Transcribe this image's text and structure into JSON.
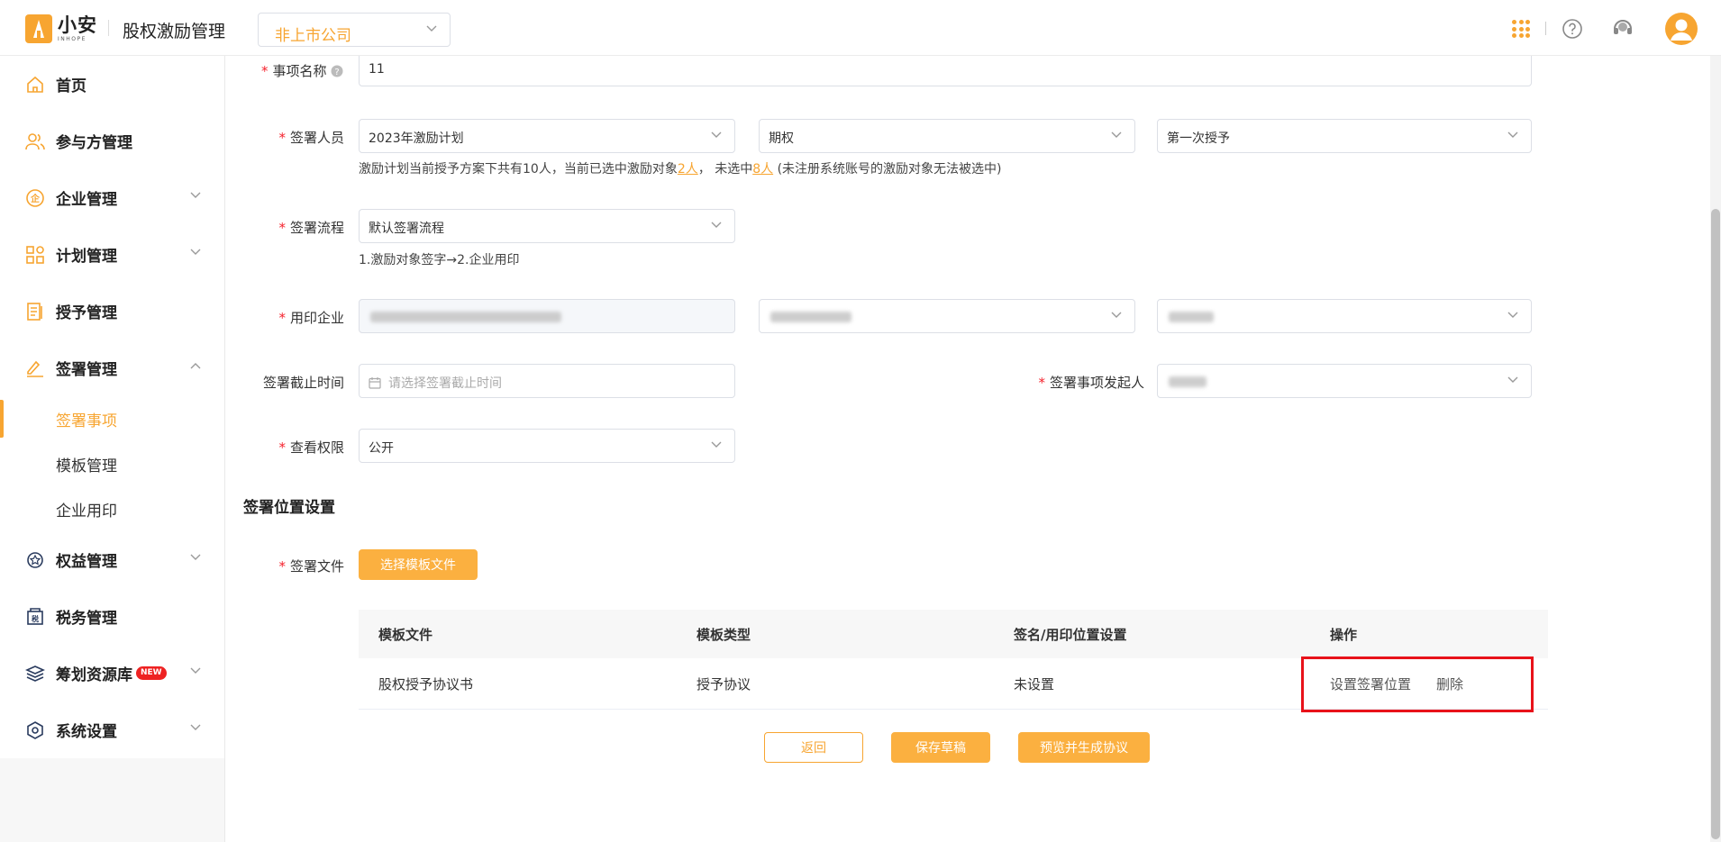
{
  "header": {
    "logo_cn": "小安",
    "logo_en": "INHOPE",
    "app_title": "股权激励管理",
    "company_select": "非上市公司"
  },
  "sidebar": {
    "items": [
      {
        "label": "首页",
        "icon": "home-icon"
      },
      {
        "label": "参与方管理",
        "icon": "users-icon"
      },
      {
        "label": "企业管理",
        "icon": "enterprise-icon"
      },
      {
        "label": "计划管理",
        "icon": "plan-icon"
      },
      {
        "label": "授予管理",
        "icon": "grant-icon"
      },
      {
        "label": "签署管理",
        "icon": "sign-icon"
      },
      {
        "label": "权益管理",
        "icon": "equity-icon"
      },
      {
        "label": "税务管理",
        "icon": "tax-icon"
      },
      {
        "label": "筹划资源库",
        "icon": "resource-icon",
        "badge": "NEW"
      },
      {
        "label": "系统设置",
        "icon": "settings-icon"
      }
    ],
    "sign_sub": [
      "签署事项",
      "模板管理",
      "企业用印"
    ]
  },
  "form": {
    "item_name_label": "事项名称",
    "item_name_value": "11",
    "signer_label": "签署人员",
    "signer_plan": "2023年激励计划",
    "signer_type": "期权",
    "signer_batch": "第一次授予",
    "signer_hint_prefix": "激励计划当前授予方案下共有10人，当前已选中激励对象",
    "signer_hint_selected": "2人",
    "signer_hint_mid": "，  未选中",
    "signer_hint_unselected": "8人",
    "signer_hint_suffix": " (未注册系统账号的激励对象无法被选中)",
    "flow_label": "签署流程",
    "flow_value": "默认签署流程",
    "flow_hint": "1.激励对象签字→2.企业用印",
    "seal_label": "用印企业",
    "deadline_label": "签署截止时间",
    "deadline_placeholder": "请选择签署截止时间",
    "initiator_label": "签署事项发起人",
    "view_label": "查看权限",
    "view_value": "公开"
  },
  "position_section": {
    "title": "签署位置设置",
    "file_label": "签署文件",
    "choose_btn": "选择模板文件"
  },
  "table": {
    "headers": [
      "模板文件",
      "模板类型",
      "签名/用印位置设置",
      "操作"
    ],
    "rows": [
      {
        "file": "股权授予协议书",
        "type": "授予协议",
        "position": "未设置",
        "op_set": "设置签署位置",
        "op_delete": "删除"
      }
    ]
  },
  "footer": {
    "back": "返回",
    "save": "保存草稿",
    "preview": "预览并生成协议"
  },
  "colors": {
    "accent": "#f7a531",
    "required": "#f5222d",
    "highlight": "#e8121a"
  }
}
